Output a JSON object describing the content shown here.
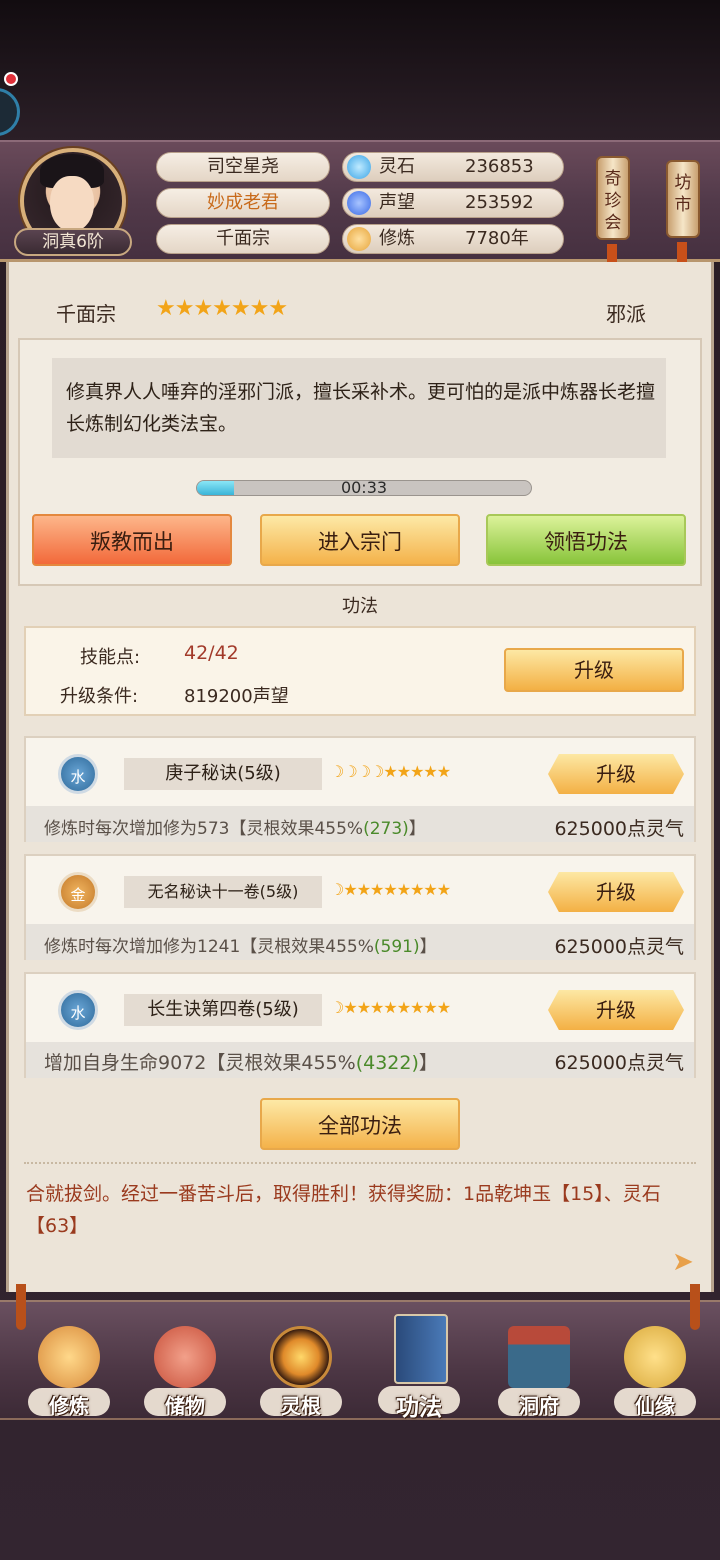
{
  "header": {
    "rank": "洞真6阶",
    "names": [
      "司空星尧",
      "妙成老君",
      "千面宗"
    ],
    "resources": [
      {
        "label": "灵石",
        "value": "236853",
        "icon": "spirit-stone-icon",
        "color": "#3aa4e6"
      },
      {
        "label": "声望",
        "value": "253592",
        "icon": "reputation-icon",
        "color": "#3a6ae6"
      },
      {
        "label": "修炼",
        "value": "7780年",
        "icon": "meditation-icon",
        "color": "#e6a43a"
      }
    ],
    "shop_buttons": [
      "奇珍会",
      "坊市"
    ]
  },
  "sect": {
    "name": "千面宗",
    "stars": "★★★★★★★",
    "alignment": "邪派",
    "description": "修真界人人唾弃的淫邪门派，擅长采补术。更可怕的是派中炼器长老擅长炼制幻化类法宝。",
    "timer": "00:33",
    "progress": 0.11,
    "buttons": {
      "leave": "叛教而出",
      "enter": "进入宗门",
      "learn": "领悟功法"
    }
  },
  "gongfa": {
    "title": "功法",
    "skill_points_label": "技能点:",
    "skill_points_value": "42/42",
    "upgrade_cond_label": "升级条件:",
    "upgrade_cond_value": "819200声望",
    "upgrade_label": "升级",
    "items": [
      {
        "element": "水",
        "name": "庚子秘诀(5级)",
        "moons": "☽☽☽☽",
        "stars": "★★★★★",
        "desc_pre": "修炼时每次增加修为573【灵根效果455%",
        "desc_val": "(273)",
        "desc_post": "】",
        "cost": "625000点灵气"
      },
      {
        "element": "金",
        "name": "无名秘诀十一卷(5级)",
        "moons": "☽",
        "stars": "★★★★★★★★",
        "desc_pre": "修炼时每次增加修为1241【灵根效果455%",
        "desc_val": "(591)",
        "desc_post": "】",
        "cost": "625000点灵气"
      },
      {
        "element": "水",
        "name": "长生诀第四卷(5级)",
        "moons": "☽",
        "stars": "★★★★★★★★",
        "desc_pre": "增加自身生命9072【灵根效果455%",
        "desc_val": "(4322)",
        "desc_post": "】",
        "cost": "625000点灵气"
      }
    ],
    "all_button": "全部功法"
  },
  "log": "合就拔剑。经过一番苦斗后，取得胜利！获得奖励：1品乾坤玉【15】、灵石【63】",
  "nav": [
    {
      "label": "修炼",
      "icon": "meditation-icon",
      "color": "#d88a3a"
    },
    {
      "label": "储物",
      "icon": "bag-icon",
      "color": "#c8503a"
    },
    {
      "label": "灵根",
      "icon": "spirit-root-icon",
      "color": "#e08a2a"
    },
    {
      "label": "功法",
      "icon": "book-icon",
      "color": "#3a6aa8"
    },
    {
      "label": "洞府",
      "icon": "cave-dwelling-icon",
      "color": "#b84a3a"
    },
    {
      "label": "仙缘",
      "icon": "gourd-icon",
      "color": "#d8a83a"
    }
  ]
}
